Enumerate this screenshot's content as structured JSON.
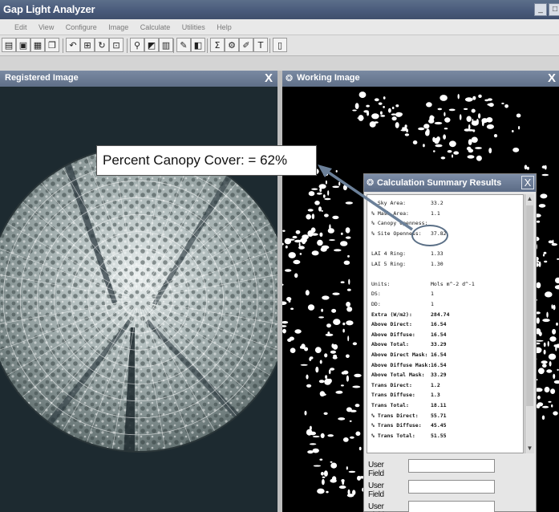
{
  "app": {
    "title": "Gap Light Analyzer"
  },
  "menu": {
    "items": [
      "Edit",
      "View",
      "Configure",
      "Image",
      "Calculate",
      "Utilities",
      "Help"
    ]
  },
  "toolbar": {
    "buttons": [
      {
        "name": "open-icon",
        "glyph": "▤"
      },
      {
        "name": "save-icon",
        "glyph": "▣"
      },
      {
        "name": "print-icon",
        "glyph": "▦"
      },
      {
        "name": "copy-icon",
        "glyph": "❐"
      },
      {
        "name": "undo-icon",
        "glyph": "↶"
      },
      {
        "name": "register-icon",
        "glyph": "⊞"
      },
      {
        "name": "rotate-icon",
        "glyph": "↻"
      },
      {
        "name": "fit-icon",
        "glyph": "⊡"
      },
      {
        "name": "zoom-icon",
        "glyph": "⚲"
      },
      {
        "name": "threshold-icon",
        "glyph": "◩"
      },
      {
        "name": "histogram-icon",
        "glyph": "▥"
      },
      {
        "name": "draw-icon",
        "glyph": "✎"
      },
      {
        "name": "layers-icon",
        "glyph": "◧"
      },
      {
        "name": "calculate-icon",
        "glyph": "Σ"
      },
      {
        "name": "settings-icon",
        "glyph": "⚙"
      },
      {
        "name": "pencil-icon",
        "glyph": "✐"
      },
      {
        "name": "text-icon",
        "glyph": "T"
      },
      {
        "name": "report-icon",
        "glyph": "▯"
      }
    ]
  },
  "panels": {
    "registered": {
      "title": "Registered Image",
      "close": "X"
    },
    "working": {
      "title": "Working Image",
      "close": "X"
    }
  },
  "callout": {
    "text": "Percent Canopy Cover: = 62%"
  },
  "summary": {
    "title": "Calculation Summary Results",
    "close": "X",
    "rows": [
      {
        "label": "% Sky Area:",
        "value": "33.2"
      },
      {
        "label": "% Mask Area:",
        "value": "1.1"
      },
      {
        "label": "% Canopy Openness:",
        "value": ""
      },
      {
        "label": "% Site Openness:",
        "value": "37.82"
      },
      {
        "label": "",
        "value": ""
      },
      {
        "label": "LAI 4 Ring:",
        "value": "1.33"
      },
      {
        "label": "LAI 5 Ring:",
        "value": "1.30"
      },
      {
        "label": "",
        "value": ""
      },
      {
        "label": "Units:",
        "value": "Mols m^-2 d^-1"
      },
      {
        "label": "DS:",
        "value": "1"
      },
      {
        "label": "DD:",
        "value": "1"
      },
      {
        "label": "Extra (W/m2):",
        "value": "284.74"
      },
      {
        "label": "Above Direct:",
        "value": "16.54"
      },
      {
        "label": "Above Diffuse:",
        "value": "16.54"
      },
      {
        "label": "Above Total:",
        "value": "33.29"
      },
      {
        "label": "Above Direct Mask:",
        "value": "16.54"
      },
      {
        "label": "Above Diffuse Mask:",
        "value": "16.54"
      },
      {
        "label": "Above Total Mask:",
        "value": "33.29"
      },
      {
        "label": "Trans Direct:",
        "value": "1.2"
      },
      {
        "label": "Trans Diffuse:",
        "value": "1.3"
      },
      {
        "label": "Trans Total:",
        "value": "18.11"
      },
      {
        "label": "% Trans Direct:",
        "value": "55.71"
      },
      {
        "label": "% Trans Diffuse:",
        "value": "45.45"
      },
      {
        "label": "% Trans Total:",
        "value": "51.55"
      }
    ],
    "user_field_label": "User Field",
    "user_fields": [
      "",
      "",
      ""
    ]
  },
  "colors": {
    "dark_bg": "#1e2a2f",
    "titlebar": "#4b5c7a",
    "arrow": "#6b8099"
  }
}
